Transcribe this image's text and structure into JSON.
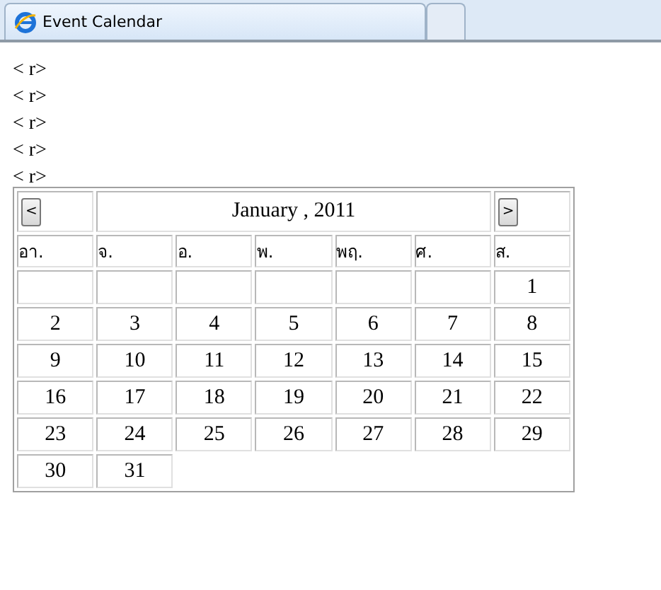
{
  "browser_tabs": [
    {
      "title": "Event Calendar",
      "selected": true
    },
    {
      "selected": false
    }
  ],
  "text_lines": [
    "< r>",
    "< r>",
    "< r>",
    "< r>",
    "< r>"
  ],
  "calendar": {
    "prev_button": "<",
    "month_title": "January , 2011",
    "next_button": ">",
    "weekdays": [
      "อา.",
      "จ.",
      "อ.",
      "พ.",
      "พฤ.",
      "ศ.",
      "ส."
    ],
    "weeks": [
      [
        {
          "kind": "blank"
        },
        {
          "kind": "blank"
        },
        {
          "kind": "blank"
        },
        {
          "kind": "blank"
        },
        {
          "kind": "blank"
        },
        {
          "kind": "blank"
        },
        {
          "kind": "day",
          "day": "1"
        }
      ],
      [
        {
          "kind": "day",
          "day": "2"
        },
        {
          "kind": "day",
          "day": "3"
        },
        {
          "kind": "day",
          "day": "4"
        },
        {
          "kind": "day",
          "day": "5"
        },
        {
          "kind": "day",
          "day": "6"
        },
        {
          "kind": "day",
          "day": "7"
        },
        {
          "kind": "day",
          "day": "8"
        }
      ],
      [
        {
          "kind": "day",
          "day": "9"
        },
        {
          "kind": "day",
          "day": "10"
        },
        {
          "kind": "day",
          "day": "11"
        },
        {
          "kind": "day",
          "day": "12"
        },
        {
          "kind": "day",
          "day": "13"
        },
        {
          "kind": "day",
          "day": "14"
        },
        {
          "kind": "day",
          "day": "15"
        }
      ],
      [
        {
          "kind": "day",
          "day": "16"
        },
        {
          "kind": "day",
          "day": "17"
        },
        {
          "kind": "day",
          "day": "18"
        },
        {
          "kind": "day",
          "day": "19"
        },
        {
          "kind": "day",
          "day": "20"
        },
        {
          "kind": "day",
          "day": "21"
        },
        {
          "kind": "day",
          "day": "22"
        }
      ],
      [
        {
          "kind": "day",
          "day": "23"
        },
        {
          "kind": "day",
          "day": "24"
        },
        {
          "kind": "day",
          "day": "25"
        },
        {
          "kind": "day",
          "day": "26"
        },
        {
          "kind": "day",
          "day": "27"
        },
        {
          "kind": "day",
          "day": "28"
        },
        {
          "kind": "day",
          "day": "29"
        }
      ],
      [
        {
          "kind": "day",
          "day": "30"
        },
        {
          "kind": "day",
          "day": "31"
        }
      ]
    ]
  }
}
